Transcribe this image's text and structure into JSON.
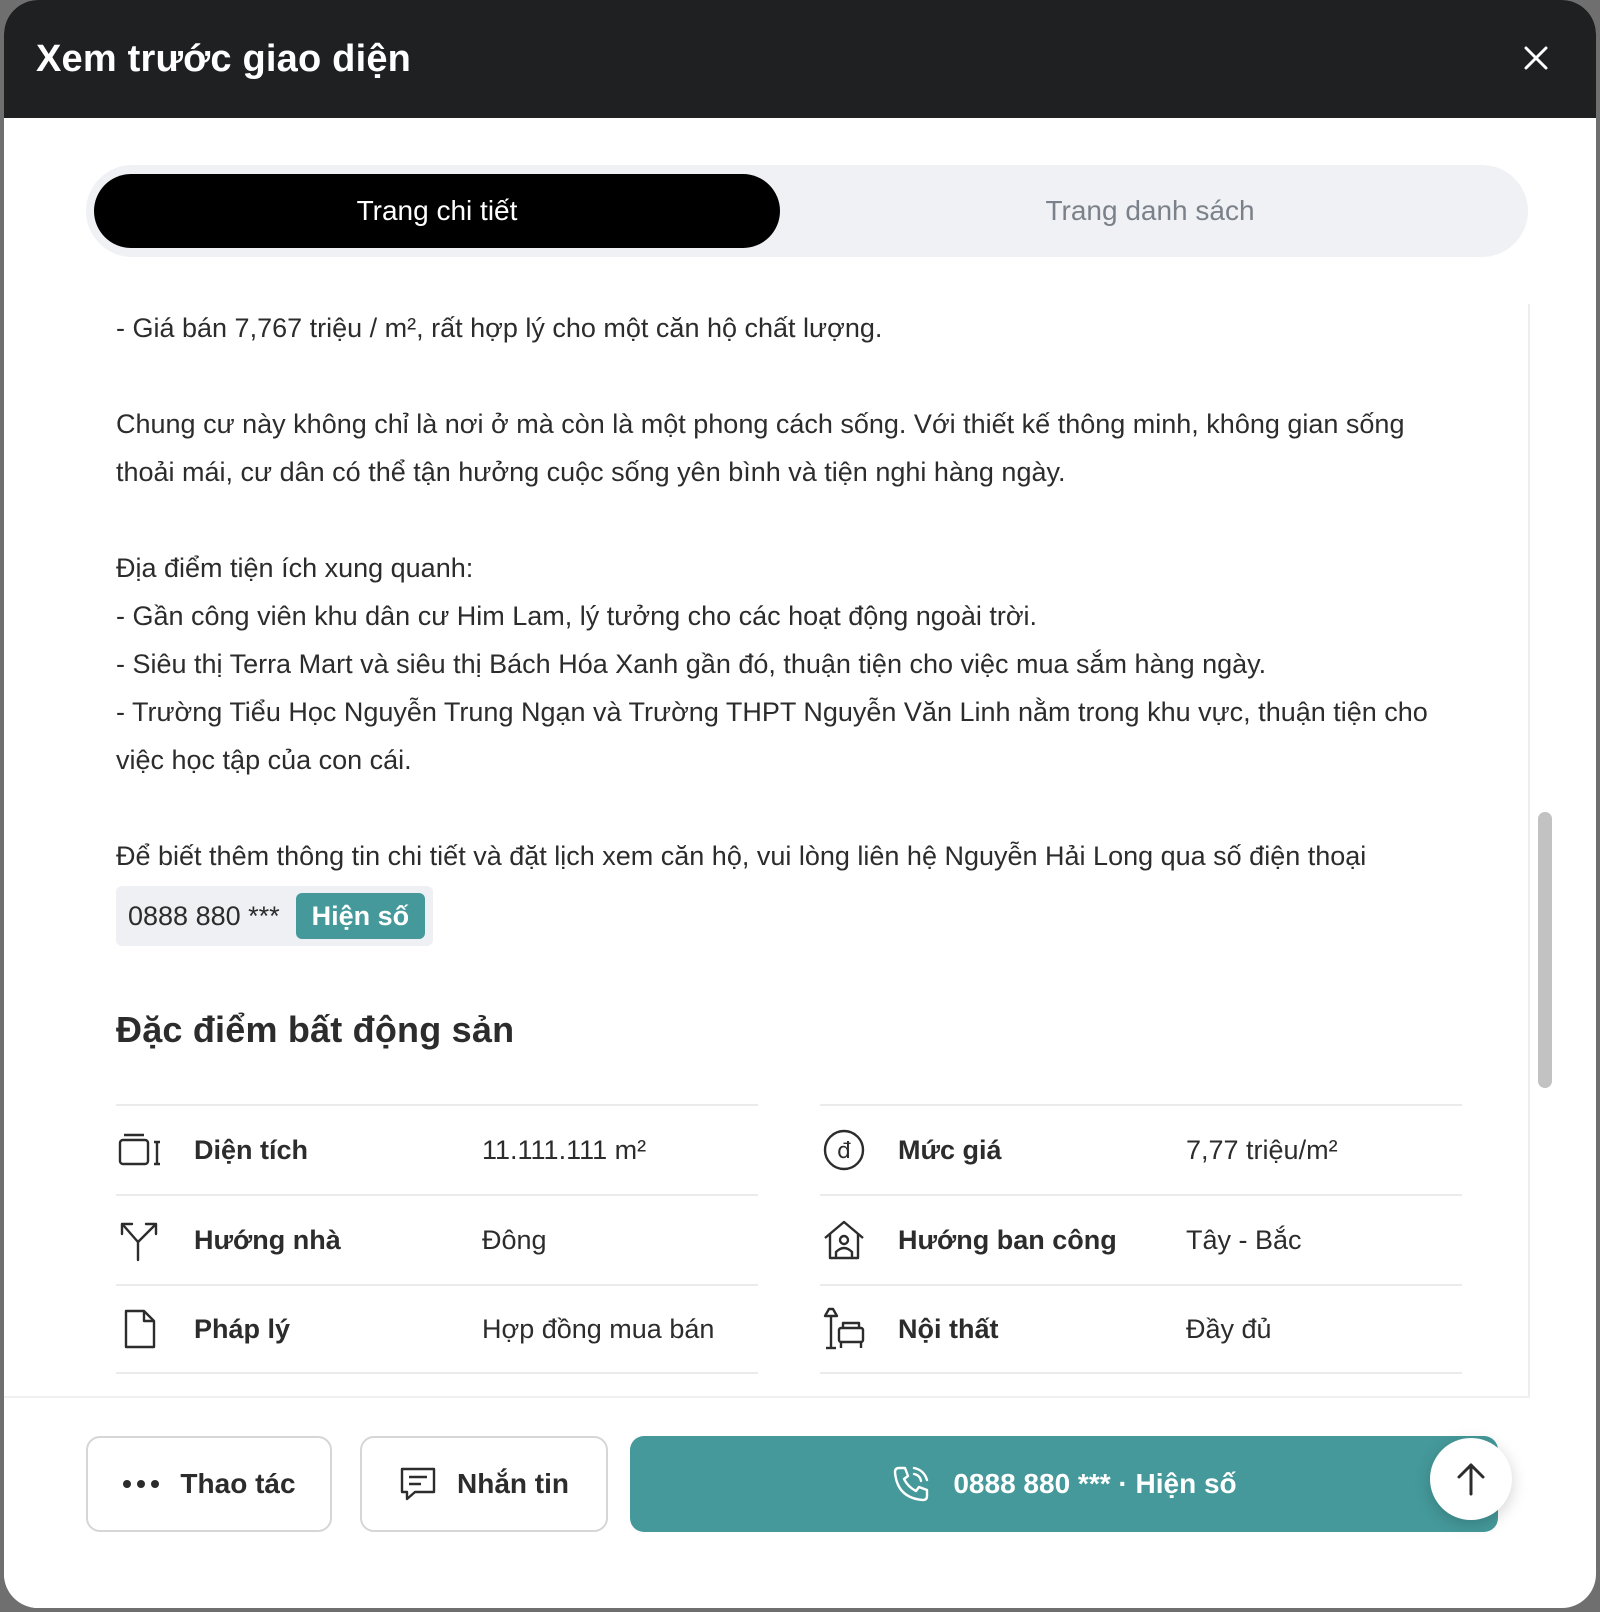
{
  "modal": {
    "title": "Xem trước giao diện"
  },
  "tabs": [
    {
      "label": "Trang chi tiết",
      "active": true
    },
    {
      "label": "Trang danh sách",
      "active": false
    }
  ],
  "description": {
    "price_line": "- Giá bán 7,767 triệu / m², rất hợp lý cho một căn hộ chất lượng.",
    "intro": "Chung cư này không chỉ là nơi ở mà còn là một phong cách sống. Với thiết kế thông minh, không gian sống thoải mái, cư dân có thể tận hưởng cuộc sống yên bình và tiện nghi hàng ngày.",
    "amenities_heading": "Địa điểm tiện ích xung quanh:",
    "amenities": [
      "- Gần công viên khu dân cư Him Lam, lý tưởng cho các hoạt động ngoài trời.",
      "- Siêu thị Terra Mart và siêu thị Bách Hóa Xanh gần đó, thuận tiện cho việc mua sắm hàng ngày.",
      "- Trường Tiểu Học Nguyễn Trung Ngạn và Trường THPT Nguyễn Văn Linh nằm trong khu vực, thuận tiện cho việc học tập của con cái."
    ],
    "contact_line": "Để biết thêm thông tin chi tiết và đặt lịch xem căn hộ, vui lòng liên hệ Nguyễn Hải Long qua số điện thoại",
    "phone_masked": "0888 880 ***",
    "reveal_label": "Hiện số"
  },
  "specs": {
    "title": "Đặc điểm bất động sản",
    "left": [
      {
        "icon": "area-icon",
        "label": "Diện tích",
        "value": "11.111.111 m²"
      },
      {
        "icon": "direction-icon",
        "label": "Hướng nhà",
        "value": "Đông"
      },
      {
        "icon": "document-icon",
        "label": "Pháp lý",
        "value": "Hợp đồng mua bán"
      }
    ],
    "right": [
      {
        "icon": "price-icon",
        "label": "Mức giá",
        "value": "7,77 triệu/m²"
      },
      {
        "icon": "balcony-house-icon",
        "label": "Hướng ban công",
        "value": "Tây - Bắc"
      },
      {
        "icon": "furniture-icon",
        "label": "Nội thất",
        "value": "Đầy đủ"
      }
    ]
  },
  "footer": {
    "actions_label": "Thao tác",
    "message_label": "Nhắn tin",
    "call_label": "0888 880 *** · Hiện số"
  },
  "colors": {
    "header_bg": "#1f2022",
    "accent": "#45999a",
    "tab_active_bg": "#000000",
    "tab_track_bg": "#f0f1f4"
  }
}
